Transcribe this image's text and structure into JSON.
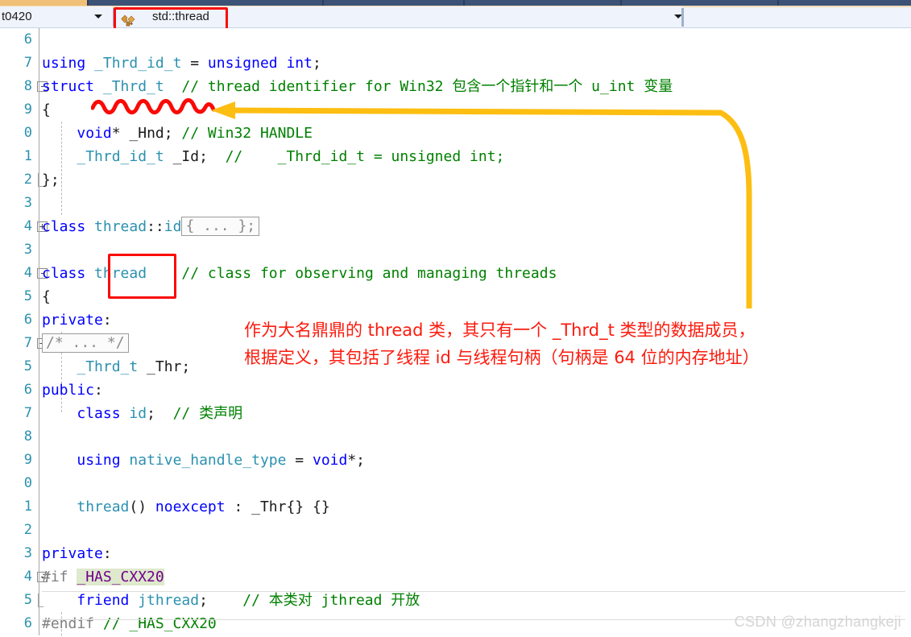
{
  "window": {
    "top_tab_color": "#f0c079",
    "chrome_color": "#3d5277"
  },
  "navbar": {
    "scope_combo": {
      "value": "t0420",
      "icon": "chevron-down-icon"
    },
    "member_combo": {
      "value": "std::thread",
      "icon": "class-icon",
      "caret": "chevron-down-icon",
      "highlight_color": "#fa0a07"
    }
  },
  "editor": {
    "lines": [
      {
        "num": "6",
        "fold": "",
        "indent": false,
        "tokens": []
      },
      {
        "num": "7",
        "fold": "",
        "indent": true,
        "tokens": [
          {
            "t": "using ",
            "c": "kw"
          },
          {
            "t": "_Thrd_id_t",
            "c": "ty"
          },
          {
            "t": " = ",
            "c": "id"
          },
          {
            "t": "unsigned int",
            "c": "kw"
          },
          {
            "t": ";",
            "c": "id"
          }
        ]
      },
      {
        "num": "8",
        "fold": "-",
        "indent": true,
        "tokens": [
          {
            "t": "struct ",
            "c": "kw"
          },
          {
            "t": "_Thrd_t",
            "c": "ty"
          },
          {
            "t": "  ",
            "c": "id"
          },
          {
            "t": "// thread identifier for Win32 包含一个指针和一个 u_int 变量",
            "c": "cm"
          }
        ]
      },
      {
        "num": "9",
        "fold": "",
        "indent": true,
        "tokens": [
          {
            "t": "{",
            "c": "id"
          }
        ]
      },
      {
        "num": "0",
        "fold": "",
        "indent": true,
        "tokens": [
          {
            "t": "    ",
            "c": "id"
          },
          {
            "t": "void",
            "c": "kw"
          },
          {
            "t": "* _Hnd; ",
            "c": "id"
          },
          {
            "t": "// Win32 HANDLE",
            "c": "cm"
          }
        ]
      },
      {
        "num": "1",
        "fold": "",
        "indent": true,
        "tokens": [
          {
            "t": "    ",
            "c": "id"
          },
          {
            "t": "_Thrd_id_t",
            "c": "ty"
          },
          {
            "t": " _Id;  ",
            "c": "id"
          },
          {
            "t": "//    _Thrd_id_t = unsigned int;",
            "c": "cm"
          }
        ]
      },
      {
        "num": "2",
        "fold": "",
        "indent": true,
        "tokens": [
          {
            "t": "};",
            "c": "id"
          }
        ]
      },
      {
        "num": "3",
        "fold": "",
        "indent": true,
        "tokens": []
      },
      {
        "num": "4",
        "fold": "+",
        "indent": true,
        "tokens": [
          {
            "t": "class ",
            "c": "kw"
          },
          {
            "t": "thread",
            "c": "ty"
          },
          {
            "t": "::",
            "c": "id"
          },
          {
            "t": "id",
            "c": "ty"
          },
          {
            "t": "{ ... };",
            "c": "collapsed"
          }
        ]
      },
      {
        "num": "3",
        "fold": "",
        "indent": true,
        "tokens": []
      },
      {
        "num": "4",
        "fold": "-",
        "indent": true,
        "tokens": [
          {
            "t": "class ",
            "c": "kw"
          },
          {
            "t": "thread",
            "c": "ty"
          },
          {
            "t": "    ",
            "c": "id"
          },
          {
            "t": "// class for observing and managing threads",
            "c": "cm"
          }
        ]
      },
      {
        "num": "5",
        "fold": "",
        "indent": true,
        "tokens": [
          {
            "t": "{",
            "c": "id"
          }
        ]
      },
      {
        "num": "6",
        "fold": "",
        "indent": true,
        "tokens": [
          {
            "t": "private",
            "c": "kw"
          },
          {
            "t": ":",
            "c": "id"
          }
        ]
      },
      {
        "num": "7",
        "fold": "+",
        "indent": true,
        "tokens": [
          {
            "t": "/* ... */",
            "c": "collapsed"
          }
        ]
      },
      {
        "num": "5",
        "fold": "",
        "indent": true,
        "tokens": [
          {
            "t": "    ",
            "c": "id"
          },
          {
            "t": "_Thrd_t",
            "c": "ty"
          },
          {
            "t": " _Thr;",
            "c": "id"
          }
        ]
      },
      {
        "num": "6",
        "fold": "",
        "indent": true,
        "tokens": [
          {
            "t": "public",
            "c": "kw"
          },
          {
            "t": ":",
            "c": "id"
          }
        ]
      },
      {
        "num": "7",
        "fold": "",
        "indent": true,
        "tokens": [
          {
            "t": "    ",
            "c": "id"
          },
          {
            "t": "class ",
            "c": "kw"
          },
          {
            "t": "id",
            "c": "ty"
          },
          {
            "t": ";  ",
            "c": "id"
          },
          {
            "t": "// 类声明",
            "c": "cm"
          }
        ]
      },
      {
        "num": "8",
        "fold": "",
        "indent": true,
        "tokens": []
      },
      {
        "num": "9",
        "fold": "",
        "indent": true,
        "tokens": [
          {
            "t": "    ",
            "c": "id"
          },
          {
            "t": "using ",
            "c": "kw"
          },
          {
            "t": "native_handle_type",
            "c": "ty"
          },
          {
            "t": " = ",
            "c": "id"
          },
          {
            "t": "void",
            "c": "kw"
          },
          {
            "t": "*;",
            "c": "id"
          }
        ]
      },
      {
        "num": "0",
        "fold": "",
        "indent": true,
        "tokens": []
      },
      {
        "num": "1",
        "fold": "",
        "indent": true,
        "tokens": [
          {
            "t": "    ",
            "c": "id"
          },
          {
            "t": "thread",
            "c": "ty"
          },
          {
            "t": "() ",
            "c": "id"
          },
          {
            "t": "noexcept",
            "c": "kw"
          },
          {
            "t": " : _Thr{} {}",
            "c": "id"
          }
        ]
      },
      {
        "num": "2",
        "fold": "",
        "indent": true,
        "tokens": []
      },
      {
        "num": "3",
        "fold": "",
        "indent": true,
        "tokens": [
          {
            "t": "private",
            "c": "kw"
          },
          {
            "t": ":",
            "c": "id"
          }
        ]
      },
      {
        "num": "4",
        "fold": "-",
        "indent": true,
        "tokens": [
          {
            "t": "#if ",
            "c": "pp"
          },
          {
            "t": "_HAS_CXX20",
            "c": "mac hl"
          }
        ]
      },
      {
        "num": "5",
        "fold": "",
        "indent": true,
        "tokens": [
          {
            "t": "    ",
            "c": "id"
          },
          {
            "t": "friend ",
            "c": "kw"
          },
          {
            "t": "jthread",
            "c": "ty"
          },
          {
            "t": ";    ",
            "c": "id"
          },
          {
            "t": "// 本类对 jthread 开放",
            "c": "cm"
          }
        ]
      },
      {
        "num": "6",
        "fold": "",
        "indent": true,
        "tokens": [
          {
            "t": "#endif ",
            "c": "pp"
          },
          {
            "t": "// _HAS_CXX20",
            "c": "cm"
          }
        ]
      }
    ]
  },
  "annotations": {
    "squiggle": {
      "color": "#fa0a07",
      "name": "red-squiggle-underline"
    },
    "arrow": {
      "color": "#fdbe12",
      "name": "yellow-curved-arrow"
    },
    "thread_highlight_box": {
      "color": "#fa0a07"
    },
    "note_line1": "作为大名鼎鼎的 thread 类，其只有一个 _Thrd_t 类型的数据成员，",
    "note_line2": "根据定义，其包括了线程 id 与线程句柄（句柄是 64 位的内存地址）",
    "note_color": "#fb1b0e"
  },
  "watermark": {
    "text": "CSDN @zhangzhangkeji"
  }
}
